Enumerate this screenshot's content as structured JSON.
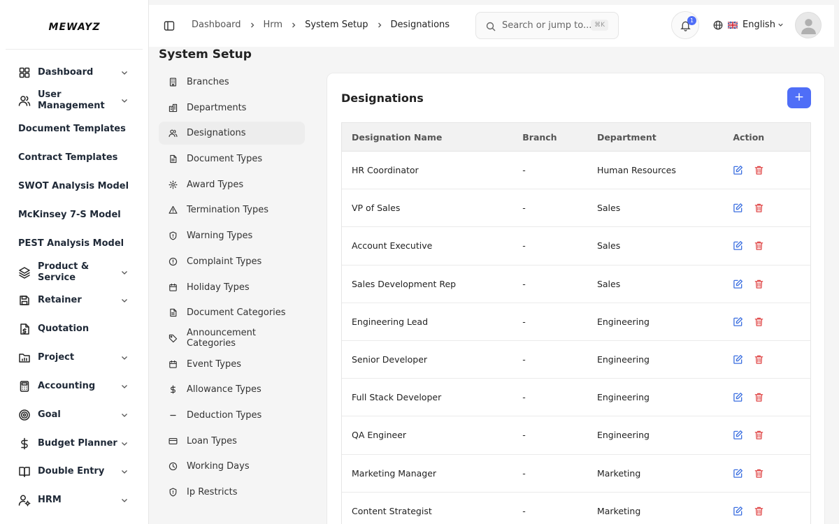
{
  "app": {
    "logo": "MEWAYZ"
  },
  "sidebar": {
    "items": [
      {
        "label": "Dashboard",
        "icon": "grid-icon",
        "has_chevron": true
      },
      {
        "label": "User Management",
        "icon": "users-icon",
        "has_chevron": true
      },
      {
        "label": "Document Templates",
        "icon": "",
        "has_chevron": false
      },
      {
        "label": "Contract Templates",
        "icon": "",
        "has_chevron": false
      },
      {
        "label": "SWOT Analysis Model",
        "icon": "",
        "has_chevron": false
      },
      {
        "label": "McKinsey 7-S Model",
        "icon": "",
        "has_chevron": false
      },
      {
        "label": "PEST Analysis Model",
        "icon": "",
        "has_chevron": false
      },
      {
        "label": "Product & Service",
        "icon": "layers-icon",
        "has_chevron": true
      },
      {
        "label": "Retainer",
        "icon": "save-icon",
        "has_chevron": true
      },
      {
        "label": "Quotation",
        "icon": "file-dollar-icon",
        "has_chevron": false
      },
      {
        "label": "Project",
        "icon": "folder-chart-icon",
        "has_chevron": true
      },
      {
        "label": "Accounting",
        "icon": "calculator-icon",
        "has_chevron": true
      },
      {
        "label": "Goal",
        "icon": "target-icon",
        "has_chevron": true
      },
      {
        "label": "Budget Planner",
        "icon": "dollar-icon",
        "has_chevron": true
      },
      {
        "label": "Double Entry",
        "icon": "book-icon",
        "has_chevron": true
      },
      {
        "label": "HRM",
        "icon": "user-cog-icon",
        "has_chevron": true
      }
    ]
  },
  "header": {
    "breadcrumb": [
      "Dashboard",
      "Hrm",
      "System Setup",
      "Designations"
    ],
    "search_placeholder": "Search or jump to...",
    "search_shortcut": "⌘K",
    "notification_count": "1",
    "language": "English"
  },
  "page": {
    "title": "System Setup"
  },
  "setup_menu": {
    "active": "Designations",
    "items": [
      {
        "label": "Branches",
        "icon": "building-icon"
      },
      {
        "label": "Departments",
        "icon": "buildings-icon"
      },
      {
        "label": "Designations",
        "icon": "users-icon"
      },
      {
        "label": "Document Types",
        "icon": "file-icon"
      },
      {
        "label": "Award Types",
        "icon": "cog-icon"
      },
      {
        "label": "Termination Types",
        "icon": "warning-triangle-icon"
      },
      {
        "label": "Warning Types",
        "icon": "shield-icon"
      },
      {
        "label": "Complaint Types",
        "icon": "alert-circle-icon"
      },
      {
        "label": "Holiday Types",
        "icon": "calendar-icon"
      },
      {
        "label": "Document Categories",
        "icon": "file-icon"
      },
      {
        "label": "Announcement Categories",
        "icon": "tag-icon"
      },
      {
        "label": "Event Types",
        "icon": "calendar-icon"
      },
      {
        "label": "Allowance Types",
        "icon": "dollar-icon"
      },
      {
        "label": "Deduction Types",
        "icon": "minus-icon"
      },
      {
        "label": "Loan Types",
        "icon": "credit-card-icon"
      },
      {
        "label": "Working Days",
        "icon": "clock-icon"
      },
      {
        "label": "Ip Restricts",
        "icon": "shield-icon"
      }
    ]
  },
  "card": {
    "title": "Designations",
    "add_label": "+",
    "columns": [
      "Designation Name",
      "Branch",
      "Department",
      "Action"
    ],
    "rows": [
      [
        "HR Coordinator",
        "-",
        "Human Resources"
      ],
      [
        "VP of Sales",
        "-",
        "Sales"
      ],
      [
        "Account Executive",
        "-",
        "Sales"
      ],
      [
        "Sales Development Rep",
        "-",
        "Sales"
      ],
      [
        "Engineering Lead",
        "-",
        "Engineering"
      ],
      [
        "Senior Developer",
        "-",
        "Engineering"
      ],
      [
        "Full Stack Developer",
        "-",
        "Engineering"
      ],
      [
        "QA Engineer",
        "-",
        "Engineering"
      ],
      [
        "Marketing Manager",
        "-",
        "Marketing"
      ],
      [
        "Content Strategist",
        "-",
        "Marketing"
      ]
    ]
  },
  "colors": {
    "accent": "#4f6ef7",
    "edit": "#3b6fe0",
    "delete": "#e04848"
  }
}
